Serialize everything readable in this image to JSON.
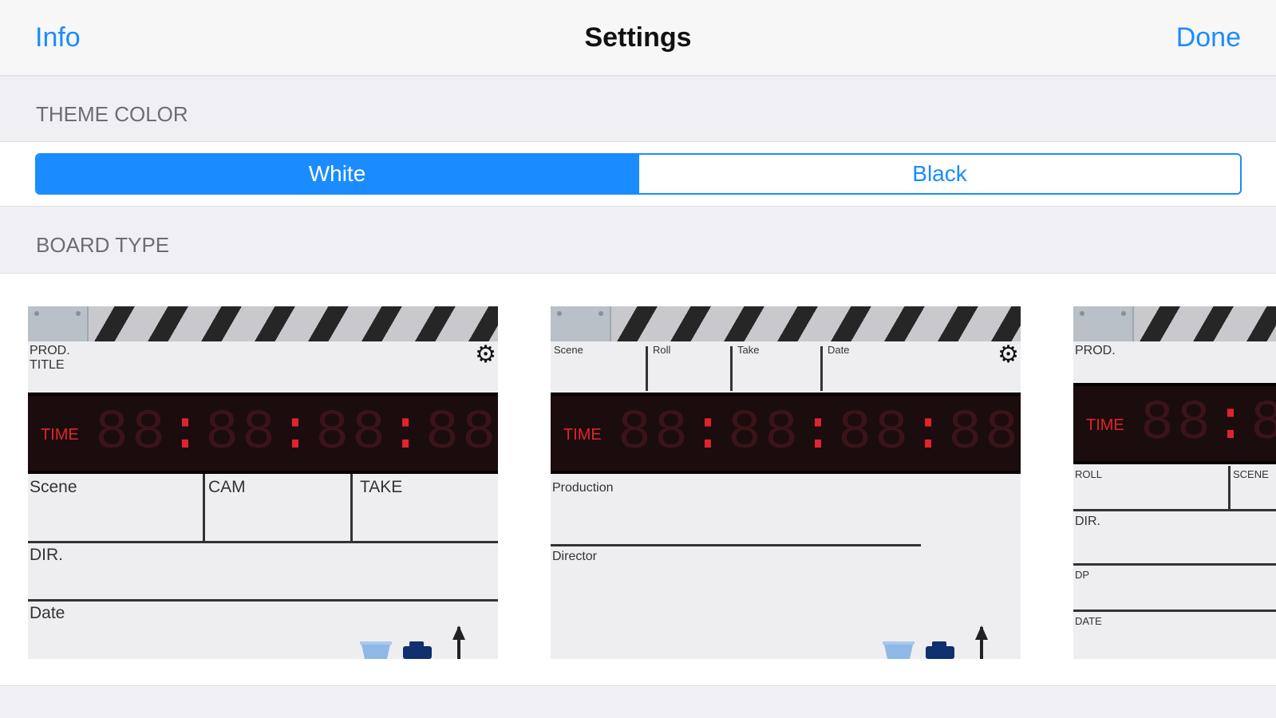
{
  "nav": {
    "left_button": "Info",
    "title": "Settings",
    "right_button": "Done"
  },
  "theme_color": {
    "header": "THEME COLOR",
    "options": [
      "White",
      "Black"
    ],
    "selected": "White"
  },
  "board_type": {
    "header": "BOARD TYPE",
    "boards": [
      {
        "top_labels": [
          "PROD.",
          "TITLE"
        ],
        "time_label": "TIME",
        "digits": [
          "88",
          "88",
          "88",
          "88"
        ],
        "fields": [
          "Scene",
          "CAM",
          "TAKE",
          "DIR.",
          "Date"
        ]
      },
      {
        "top_labels": [
          "Scene",
          "Roll",
          "Take",
          "Date"
        ],
        "time_label": "TIME",
        "digits": [
          "88",
          "88",
          "88",
          "88"
        ],
        "fields": [
          "Production",
          "Director"
        ]
      },
      {
        "top_labels": [
          "PROD."
        ],
        "time_label": "TIME",
        "digits": [
          "88",
          "88"
        ],
        "fields": [
          "ROLL",
          "SCENE",
          "DIR.",
          "DP",
          "DATE"
        ]
      }
    ]
  },
  "icons": {
    "settings": "gear-icon",
    "trash": "trash-icon",
    "camera": "camera-icon",
    "microphone": "mic-stand-icon"
  },
  "colors": {
    "accent": "#1a8cff",
    "timecode_red": "#e0242b",
    "timecode_bg": "#1b0c0e"
  }
}
